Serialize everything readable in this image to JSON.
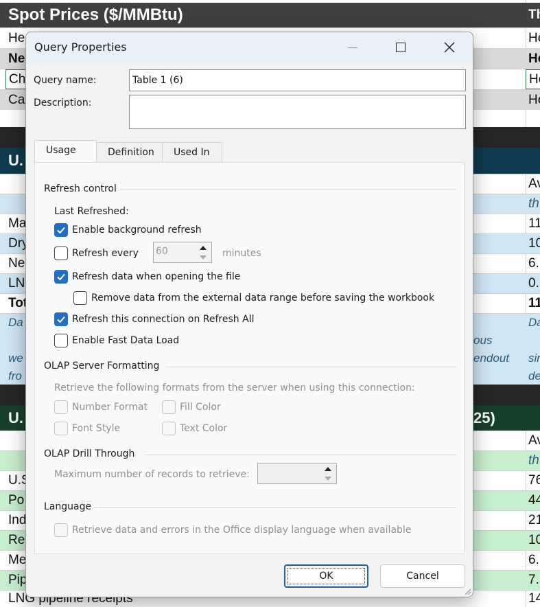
{
  "spreadsheet": {
    "header1": "Spot Prices ($/MMBtu)",
    "header1_right": "Th",
    "rows_top": [
      {
        "a": "He",
        "z": "He"
      },
      {
        "a": "Ne",
        "z": "He"
      },
      {
        "a": "Ch",
        "z": "He"
      },
      {
        "a": "Ca",
        "z": "He"
      }
    ],
    "header2": "U.",
    "rows_mid": [
      {
        "a": "",
        "z": "Av"
      },
      {
        "a": "",
        "z": "th"
      },
      {
        "a": "Ma",
        "z": "11"
      },
      {
        "a": "Dry",
        "z": "10"
      },
      {
        "a": "Ne",
        "z": "6."
      },
      {
        "a": "LN",
        "z": "0."
      },
      {
        "a": "Tot",
        "z": "11"
      }
    ],
    "note_left": [
      "Da",
      "we",
      "fro"
    ],
    "note_mid": [
      "ous",
      "endout"
    ],
    "note_right": [
      "Da",
      "sin",
      "de"
    ],
    "header3_left": "U.",
    "header3_right": "25)",
    "rows_bottom": [
      {
        "a": "",
        "z": "Av"
      },
      {
        "a": "",
        "z": "th"
      },
      {
        "a": "U.S",
        "z": "76"
      },
      {
        "a": "Po",
        "z": "44"
      },
      {
        "a": "Ind",
        "z": "21"
      },
      {
        "a": "Re",
        "z": "10"
      },
      {
        "a": "Me",
        "z": "6."
      },
      {
        "a": "Pip",
        "z": "7."
      }
    ],
    "last_row": {
      "a": "LNG pipeline receipts",
      "z": "14"
    }
  },
  "dialog": {
    "title": "Query Properties",
    "query_name_label": "Query name:",
    "query_name_value": "Table 1 (6)",
    "description_label": "Description:",
    "description_value": "",
    "tabs": [
      {
        "label": "Usage",
        "active": true
      },
      {
        "label": "Definition",
        "active": false
      },
      {
        "label": "Used In",
        "active": false
      }
    ],
    "refresh_control": {
      "heading": "Refresh control",
      "last_refreshed": "Last Refreshed:",
      "enable_background_refresh": {
        "label": "Enable background refresh",
        "checked": true
      },
      "refresh_every": {
        "label": "Refresh every",
        "checked": false,
        "value": "60",
        "unit": "minutes"
      },
      "refresh_on_open": {
        "label": "Refresh data when opening the file",
        "checked": true
      },
      "remove_data": {
        "label": "Remove data from the external data range before saving the workbook",
        "checked": false
      },
      "refresh_all": {
        "label": "Refresh this connection on Refresh All",
        "checked": true
      },
      "fast_load": {
        "label": "Enable Fast Data Load",
        "checked": false
      }
    },
    "olap_formatting": {
      "heading": "OLAP Server Formatting",
      "description": "Retrieve the following formats from the server when using this connection:",
      "number_format": "Number Format",
      "fill_color": "Fill Color",
      "font_style": "Font Style",
      "text_color": "Text Color"
    },
    "olap_drill": {
      "heading": "OLAP Drill Through",
      "max_records_label": "Maximum number of records to retrieve:",
      "max_records_value": ""
    },
    "language": {
      "heading": "Language",
      "office_language": "Retrieve data and errors in the Office display language when available"
    },
    "ok_label": "OK",
    "cancel_label": "Cancel",
    "colors": {
      "accent": "#1f6fc5",
      "titlebar": "#e8f1f8"
    }
  }
}
